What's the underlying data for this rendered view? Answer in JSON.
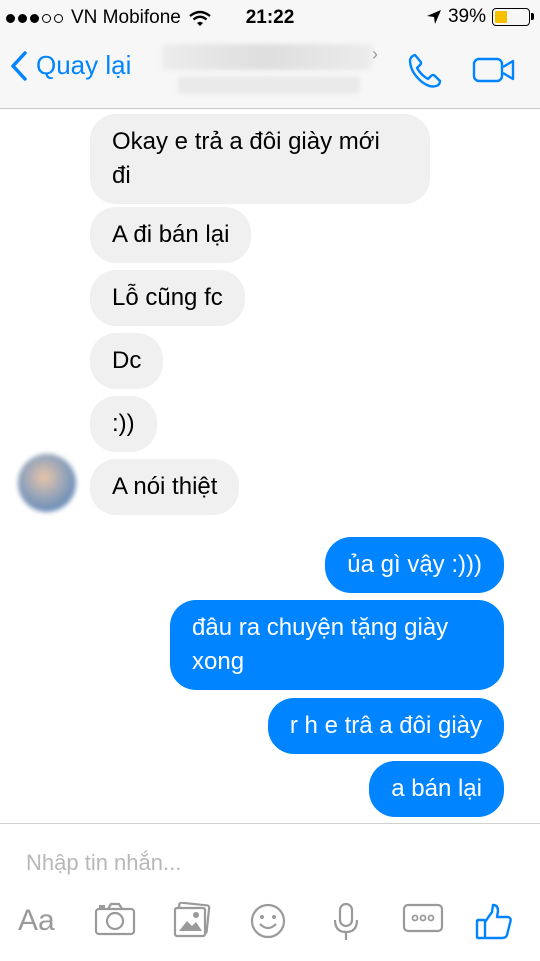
{
  "status_bar": {
    "carrier": "VN Mobifone",
    "time": "21:22",
    "battery": "39%",
    "battery_level": 0.39
  },
  "nav": {
    "back_label": "Quay lại",
    "chevron": "›",
    "icons": [
      "back-chevron-icon",
      "phone-icon",
      "video-camera-icon"
    ]
  },
  "messages": [
    {
      "dir": "in",
      "text": "Okay e trả a đôi giày mới\nđi"
    },
    {
      "dir": "in",
      "text": "A đi bán lại"
    },
    {
      "dir": "in",
      "text": "Lỗ cũng fc"
    },
    {
      "dir": "in",
      "text": "Dc"
    },
    {
      "dir": "in",
      "text": ":))"
    },
    {
      "dir": "in",
      "text": "A nói thiệt"
    },
    {
      "dir": "out",
      "text": "ủa gì vậy :)))"
    },
    {
      "dir": "out",
      "text": "đâu ra chuyện tặng giày\nxong"
    },
    {
      "dir": "out",
      "text": "r h e trâ a đôi giày"
    },
    {
      "dir": "out",
      "text": "a bán lại"
    }
  ],
  "composer": {
    "placeholder": "Nhập tin nhắn...",
    "aa_label": "Aa",
    "icons": [
      "camera-icon",
      "gallery-icon",
      "emoji-icon",
      "microphone-icon",
      "more-icon",
      "thumbs-up-icon"
    ]
  },
  "colors": {
    "accent": "#0084ff",
    "incoming_bubble": "#f1f0f0",
    "battery": "#f5c000"
  }
}
